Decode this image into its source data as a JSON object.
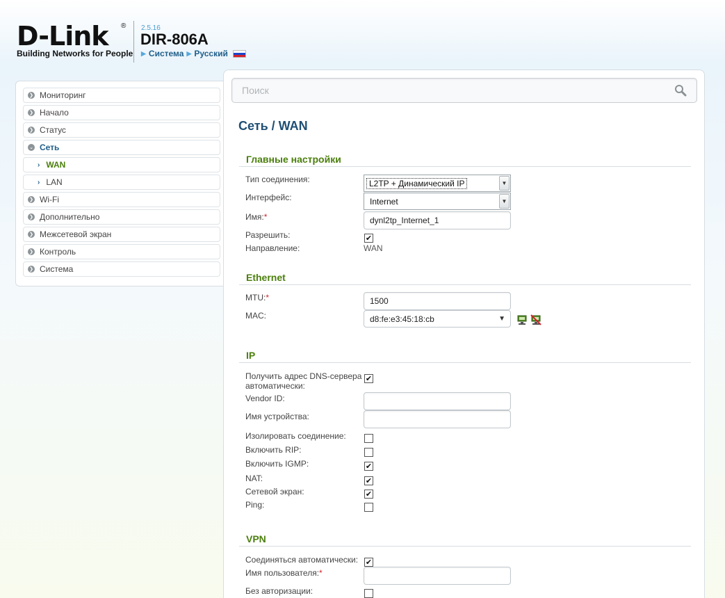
{
  "header": {
    "logo_text": "D-Link",
    "logo_tagline": "Building Networks for People",
    "firmware_version": "2.5.16",
    "model": "DIR-806A",
    "crumb_system": "Система",
    "crumb_language": "Русский"
  },
  "sidebar": {
    "items": [
      {
        "label": "Мониторинг"
      },
      {
        "label": "Начало"
      },
      {
        "label": "Статус"
      },
      {
        "label": "Сеть"
      },
      {
        "label": "WAN"
      },
      {
        "label": "LAN"
      },
      {
        "label": "Wi-Fi"
      },
      {
        "label": "Дополнительно"
      },
      {
        "label": "Межсетевой экран"
      },
      {
        "label": "Контроль"
      },
      {
        "label": "Система"
      }
    ]
  },
  "search": {
    "placeholder": "Поиск"
  },
  "page": {
    "title_prefix": "Сеть /",
    "title": "WAN"
  },
  "main_settings": {
    "section_title": "Главные настройки",
    "connection_type_label": "Тип соединения:",
    "connection_type_value": "L2TP + Динамический IP",
    "interface_label": "Интерфейс:",
    "interface_value": "Internet",
    "name_label": "Имя:",
    "name_value": "dynl2tp_Internet_1",
    "enable_label": "Разрешить:",
    "enable_checked": true,
    "direction_label": "Направление:",
    "direction_value": "WAN"
  },
  "ethernet": {
    "section_title": "Ethernet",
    "mtu_label": "MTU:",
    "mtu_value": "1500",
    "mac_label": "MAC:",
    "mac_value": "d8:fe:e3:45:18:cb"
  },
  "ip": {
    "section_title": "IP",
    "dns_auto_label_line1": "Получить адрес DNS-сервера",
    "dns_auto_label_line2": "автоматически:",
    "vendor_id_label": "Vendor ID:",
    "vendor_id_value": "",
    "device_name_label": "Имя устройства:",
    "device_name_value": "",
    "isolate_label": "Изолировать соединение:",
    "rip_label": "Включить RIP:",
    "igmp_label": "Включить IGMP:",
    "nat_label": "NAT:",
    "firewall_label": "Сетевой экран:",
    "ping_label": "Ping:"
  },
  "vpn": {
    "section_title": "VPN",
    "auto_connect_label": "Соединяться автоматически:",
    "username_label": "Имя пользователя:",
    "username_value": "",
    "no_auth_label": "Без авторизации:"
  },
  "required_mark": "*",
  "check_mark": "✔"
}
